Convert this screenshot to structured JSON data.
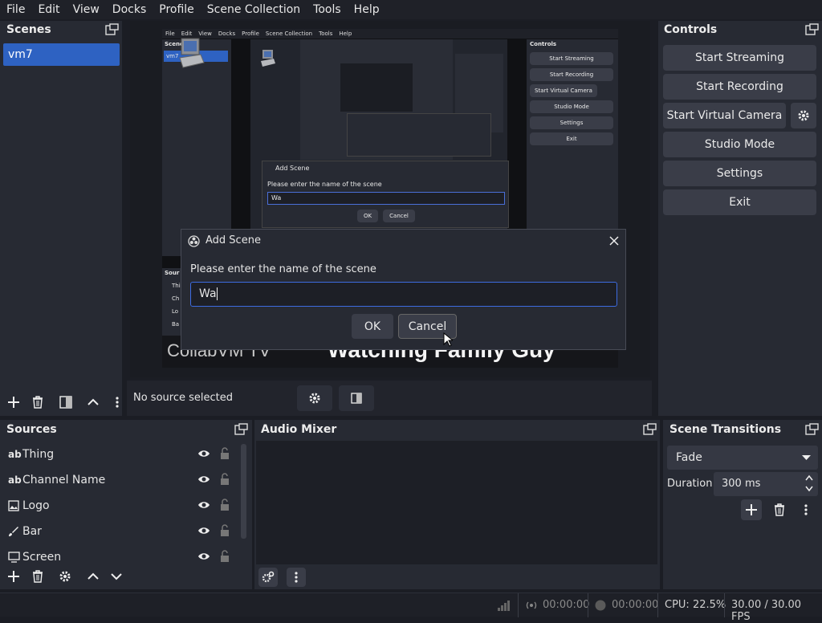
{
  "menu": [
    "File",
    "Edit",
    "View",
    "Docks",
    "Profile",
    "Scene Collection",
    "Tools",
    "Help"
  ],
  "scenes": {
    "title": "Scenes",
    "items": [
      "vm7"
    ]
  },
  "controls": {
    "title": "Controls",
    "start_streaming": "Start Streaming",
    "start_recording": "Start Recording",
    "start_virtual_camera": "Start Virtual Camera",
    "studio_mode": "Studio Mode",
    "settings": "Settings",
    "exit": "Exit"
  },
  "preview": {
    "nested_menu": [
      "File",
      "Edit",
      "View",
      "Docks",
      "Profile",
      "Scene Collection",
      "Tools",
      "Help"
    ],
    "nested_scenes_label": "Scenes",
    "nested_scene_item": "vm7",
    "nested_controls": {
      "title": "Controls",
      "items": [
        "Start Streaming",
        "Start Recording",
        "Start Virtual Camera",
        "Studio Mode",
        "Settings",
        "Exit"
      ]
    },
    "nested_sources_label": "Sour",
    "nested_source_rows": [
      "Thi",
      "Ch",
      "Lo",
      "Ba"
    ],
    "nested_dialog": {
      "title": "Add Scene",
      "prompt": "Please enter the name of the scene",
      "value": "Wa",
      "ok": "OK",
      "cancel": "Cancel"
    },
    "channel_text": "CollabVM TV",
    "banner_text": "Watching Family Guy"
  },
  "source_toolbar": {
    "label": "No source selected"
  },
  "dialog": {
    "title": "Add Scene",
    "prompt": "Please enter the name of the scene",
    "value": "Wa",
    "ok": "OK",
    "cancel": "Cancel"
  },
  "sources": {
    "title": "Sources",
    "items": [
      {
        "name": "Thing",
        "icon": "text-icon"
      },
      {
        "name": "Channel Name",
        "icon": "text-icon"
      },
      {
        "name": "Logo",
        "icon": "image-icon"
      },
      {
        "name": "Bar",
        "icon": "brush-icon"
      },
      {
        "name": "Screen",
        "icon": "monitor-icon"
      }
    ],
    "text_glyph": "ab"
  },
  "audio_mixer": {
    "title": "Audio Mixer"
  },
  "transitions": {
    "title": "Scene Transitions",
    "selected": "Fade",
    "duration_label": "Duration",
    "duration_value": "300 ms"
  },
  "statusbar": {
    "stream_time": "00:00:00",
    "record_time": "00:00:00",
    "cpu": "CPU: 22.5%",
    "fps": "30.00 / 30.00 FPS"
  },
  "colors": {
    "accent": "#2e62c2",
    "panel": "#272a33",
    "background": "#1b1d24"
  }
}
